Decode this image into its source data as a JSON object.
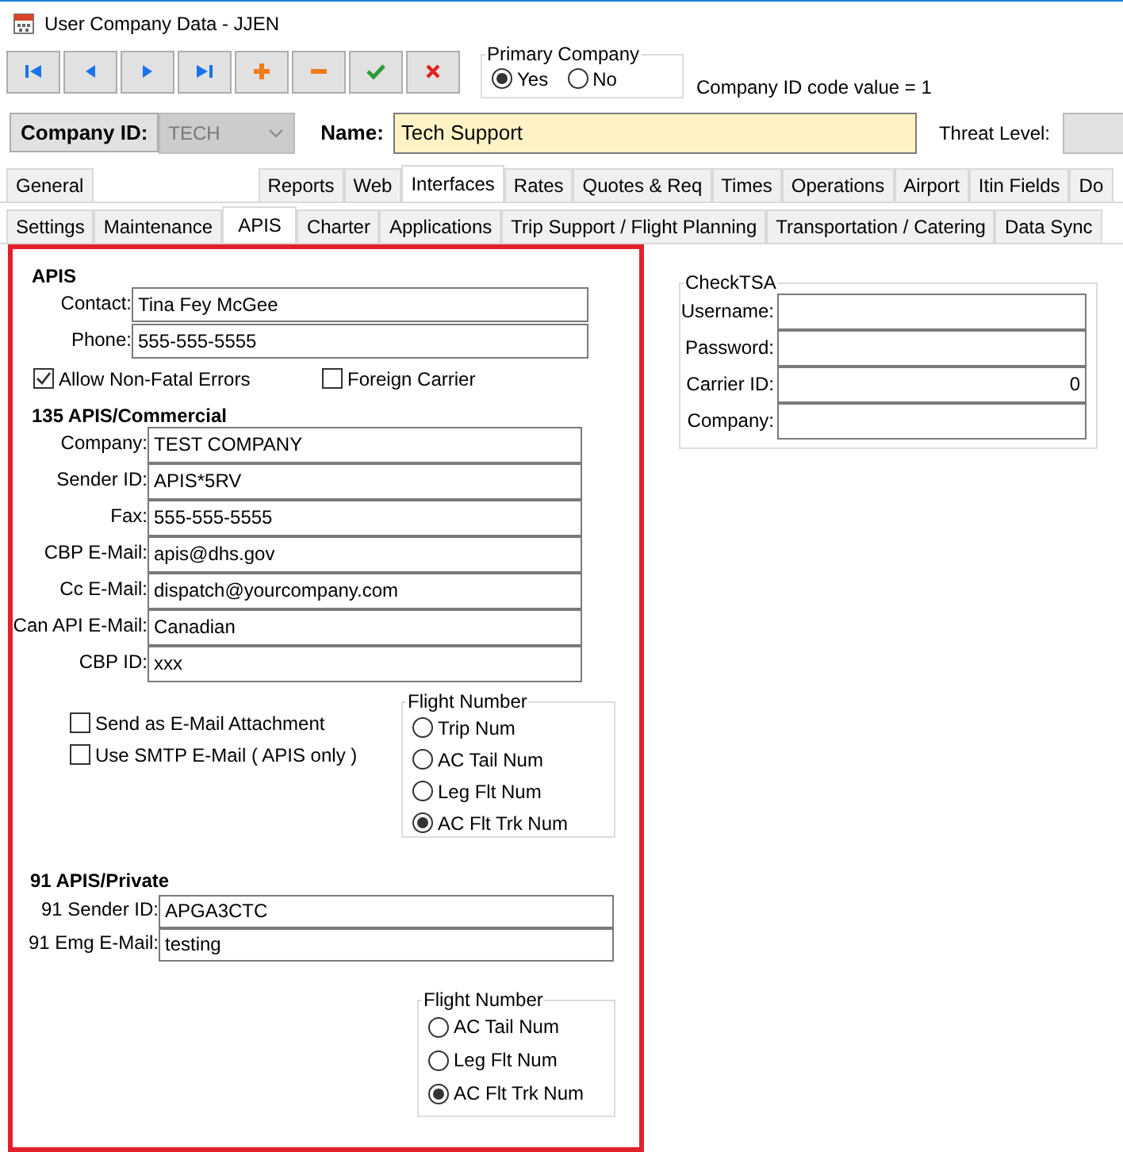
{
  "window": {
    "title": "User Company Data - JJEN"
  },
  "toolbar": {
    "buttons": [
      {
        "kind": "first"
      },
      {
        "kind": "previous"
      },
      {
        "kind": "next"
      },
      {
        "kind": "last"
      },
      {
        "kind": "add"
      },
      {
        "kind": "remove"
      },
      {
        "kind": "save"
      },
      {
        "kind": "cancel"
      }
    ]
  },
  "primary_company": {
    "title": "Primary Company",
    "options": [
      {
        "label": "Yes",
        "selected": true
      },
      {
        "label": "No",
        "selected": false
      }
    ]
  },
  "company_code_note": "Company ID code value = 1",
  "company_id": {
    "label": "Company ID:",
    "value": "TECH",
    "disabled": true
  },
  "name": {
    "label": "Name:",
    "value": "Tech Support"
  },
  "threat_level": {
    "label": "Threat Level:"
  },
  "tabs": [
    {
      "label": "General",
      "selected": false
    },
    {
      "kind": "blank"
    },
    {
      "label": "Reports",
      "selected": false
    },
    {
      "label": "Web",
      "selected": false
    },
    {
      "label": "Interfaces",
      "selected": true
    },
    {
      "label": "Rates",
      "selected": false
    },
    {
      "label": "Quotes & Req",
      "selected": false
    },
    {
      "label": "Times",
      "selected": false
    },
    {
      "label": "Operations",
      "selected": false
    },
    {
      "label": "Airport",
      "selected": false
    },
    {
      "label": "Itin Fields",
      "selected": false
    },
    {
      "label": "Do",
      "selected": false
    }
  ],
  "subtabs": [
    {
      "label": "Settings",
      "selected": false
    },
    {
      "label": "Maintenance",
      "selected": false
    },
    {
      "label": "APIS",
      "selected": true
    },
    {
      "label": "Charter",
      "selected": false
    },
    {
      "label": "Applications",
      "selected": false
    },
    {
      "label": "Trip Support / Flight Planning",
      "selected": false
    },
    {
      "label": "Transportation / Catering",
      "selected": false
    },
    {
      "label": "Data Sync",
      "selected": false
    }
  ],
  "apis": {
    "heading": "APIS",
    "fields": [
      {
        "label": "Contact:",
        "value": "Tina Fey McGee"
      },
      {
        "label": "Phone:",
        "value": "555-555-5555"
      }
    ],
    "checkboxes": [
      {
        "label": "Allow Non-Fatal Errors",
        "checked": true
      },
      {
        "label": "Foreign Carrier",
        "checked": false
      }
    ],
    "commercial": {
      "heading": "135 APIS/Commercial",
      "fields": [
        {
          "label": "Company:",
          "value": "TEST COMPANY"
        },
        {
          "label": "Sender ID:",
          "value": "APIS*5RV"
        },
        {
          "label": "Fax:",
          "value": "555-555-5555"
        },
        {
          "label": "CBP E-Mail:",
          "value": "apis@dhs.gov"
        },
        {
          "label": "Cc E-Mail:",
          "value": "dispatch@yourcompany.com"
        },
        {
          "label": "Can API E-Mail:",
          "value": "Canadian"
        },
        {
          "label": "CBP ID:",
          "value": "xxx"
        }
      ],
      "checkboxes": [
        {
          "label": "Send as E-Mail Attachment",
          "checked": false
        },
        {
          "label": "Use SMTP E-Mail ( APIS only )",
          "checked": false
        }
      ],
      "flight_number": {
        "title": "Flight Number",
        "options": [
          {
            "label": "Trip Num",
            "selected": false
          },
          {
            "label": "AC Tail Num",
            "selected": false
          },
          {
            "label": "Leg Flt Num",
            "selected": false
          },
          {
            "label": "AC Flt Trk Num",
            "selected": true
          }
        ]
      }
    },
    "private": {
      "heading": "91 APIS/Private",
      "fields": [
        {
          "label": "91 Sender ID:",
          "value": "APGA3CTC"
        },
        {
          "label": "91 Emg E-Mail:",
          "value": "testing"
        }
      ],
      "flight_number": {
        "title": "Flight Number",
        "options": [
          {
            "label": "AC Tail Num",
            "selected": false
          },
          {
            "label": "Leg Flt Num",
            "selected": false
          },
          {
            "label": "AC Flt Trk Num",
            "selected": true
          }
        ]
      }
    }
  },
  "checktsa": {
    "title": "CheckTSA",
    "fields": [
      {
        "label": "Username:",
        "kind": "text"
      },
      {
        "label": "Password:",
        "kind": "text"
      },
      {
        "label": "Carrier ID:",
        "value": "0",
        "kind": "number"
      },
      {
        "label": "Company:",
        "kind": "text"
      }
    ]
  }
}
